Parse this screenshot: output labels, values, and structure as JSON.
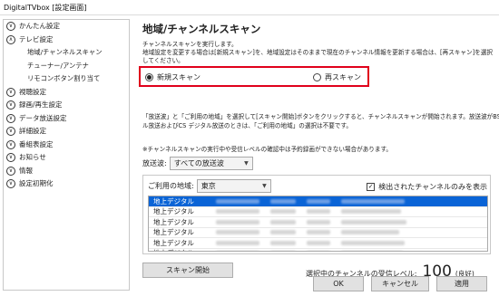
{
  "window": {
    "title": "DigitalTVbox [設定画面]"
  },
  "sidebar": {
    "items": [
      {
        "label": "かんたん設定",
        "chevron": "down"
      },
      {
        "label": "テレビ設定",
        "chevron": "up"
      },
      {
        "label": "地域/チャンネルスキャン",
        "sub": true
      },
      {
        "label": "チューナー/アンテナ",
        "sub": true
      },
      {
        "label": "リモコンボタン割り当て",
        "sub": true
      },
      {
        "label": "視聴設定",
        "chevron": "down"
      },
      {
        "label": "録画/再生設定",
        "chevron": "down"
      },
      {
        "label": "データ放送設定",
        "chevron": "down"
      },
      {
        "label": "詳細設定",
        "chevron": "down"
      },
      {
        "label": "番組表設定",
        "chevron": "down"
      },
      {
        "label": "お知らせ",
        "chevron": "down"
      },
      {
        "label": "情報",
        "chevron": "down"
      },
      {
        "label": "設定初期化",
        "chevron": "down"
      }
    ]
  },
  "main": {
    "title": "地域/チャンネルスキャン",
    "description": [
      "チャンネルスキャンを実行します。",
      "地域設定を変更する場合は[新規スキャン]を、地域設定はそのままで現在のチャンネル情報を更新する場合は、[再スキャン]を選択",
      "してください。"
    ],
    "radios": {
      "new_scan": {
        "label": "新規スキャン",
        "checked": true
      },
      "rescan": {
        "label": "再スキャン",
        "checked": false
      }
    },
    "note1": [
      "「放送波」と「ご利用の地域」を選択して[スキャン開始]ボタンをクリックすると、チャンネルスキャンが開始されます。放送波がBS デジタ",
      "ル放送およびCS デジタル放送のときは、「ご利用の地域」の選択は不要です。"
    ],
    "note2": "※チャンネルスキャンの実行中や受信レベルの確認中は予約録画ができない場合があります。",
    "broadcast": {
      "label": "放送波:",
      "value": "すべての放送波"
    },
    "area": {
      "label": "ご利用の地域:",
      "value": "東京"
    },
    "only_detected": {
      "label": "検出されたチャンネルのみを表示",
      "checked": true
    },
    "channel_rows": [
      {
        "type": "地上デジタル",
        "selected": true
      },
      {
        "type": "地上デジタル",
        "selected": false
      },
      {
        "type": "地上デジタル",
        "selected": false
      },
      {
        "type": "地上デジタル",
        "selected": false
      },
      {
        "type": "地上デジタル",
        "selected": false
      },
      {
        "type": "地上デジタル",
        "selected": false
      }
    ],
    "scan_start_label": "スキャン開始",
    "signal": {
      "label": "選択中のチャンネルの受信レベル:",
      "value": "100",
      "quality": "(良好)"
    }
  },
  "footer": {
    "ok": "OK",
    "cancel": "キャンセル",
    "apply": "適用"
  },
  "colors": {
    "highlight_box": "#e0001b",
    "selection": "#0a64d6"
  }
}
